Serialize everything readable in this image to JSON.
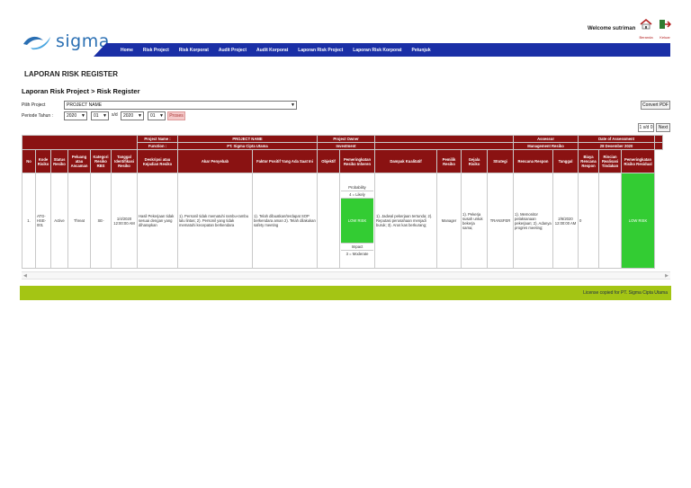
{
  "header": {
    "brand": "sigma",
    "welcome": "Welcome sutriman",
    "home_label": "Beranda",
    "exit_label": "Keluar"
  },
  "nav": {
    "items": [
      "Home",
      "Risk Project",
      "Risk Korporat",
      "Audit Project",
      "Audit Korporat",
      "Laporan Risk Project",
      "Laporan Risk Korporat",
      "Petunjuk"
    ]
  },
  "page": {
    "heading": "LAPORAN RISK REGISTER",
    "breadcrumb": "Laporan Risk Project > Risk Register"
  },
  "filters": {
    "project_label": "Pilih Project",
    "project_value": "PROJECT NAME",
    "periode_label": "Periode Tahun :",
    "year_from": "2020",
    "month_from": "01",
    "sd": "s/d",
    "year_to": "2020",
    "month_to": "01",
    "proses": "Proses",
    "convert_pdf": "Convert PDF",
    "pager": "1 s/d 0",
    "next": "Next"
  },
  "table": {
    "project_name_label": "Project Name :",
    "project_name_value": "PROJECT NAME",
    "function_label": "Function :",
    "function_value": "PT. Sigma Cipta Utama",
    "project_owner_label": "Project Owner",
    "investment_label": "Investment",
    "assessor_label": "Assessor",
    "management_label": "Management Resiko",
    "date_label": "Date of Assessment",
    "date_value": "28 Desember 2020",
    "columns": [
      "No",
      "Kode Risiko",
      "Status Resiko",
      "Peluang atau Ancaman",
      "Kategori Resiko RBS",
      "Tanggal Identifikasi Resiko",
      "Deskripsi atau Kejadian Resiko",
      "Akar Penyebab",
      "Faktor Positif Yang Ada Saat Ini",
      "Objektif",
      "Pemeringkatan Resiko Inheren",
      "Dampak Kualitatif",
      "Pemilik Resiko",
      "Gejala Risiko",
      "Strategi",
      "Rencana Respon",
      "Tanggal",
      "Biaya Rencana Respon",
      "Rincian Realisasi Tindakan",
      "Pemeringkatan Risiko Residual"
    ],
    "row": {
      "no": "1.",
      "kode": "ATG-HSE-001",
      "status": "Active",
      "peluang": "Threat",
      "kategori": "SE-",
      "tanggal": "1/4/2020 12:00:00 AM",
      "deskripsi": "Hasil Pekerjaan tidak sesuai dengan yang diharapkan",
      "akar": "1). Personil tidak mematuhi rambu-rambu lalu lintas; 2). Personil yang tidak mematuhi kecepatan berkendara",
      "faktor": "1). Telah dibuatkan/terdapat SOP berkendara aman 2). Telah dilakukan safety meeting",
      "objektif": "",
      "probability_label": "Probability",
      "probability_value": "4 = Likely",
      "inheren": "LOW RISK",
      "impact_label": "Impact",
      "impact_value": "3 = Moderate",
      "dampak": "1). Jadwal pekerjaan tertunda; 2). Reputasi perusahaan menjadi buruk; 3). Arus kas berkurang;",
      "pemilik": "Manager",
      "gejala": "1). Pekerja susah untuk bekerja sama;",
      "strategi": "TRANSFER",
      "rencana": "1). Memonitor pelaksanaan pekerjaan; 2). Adanya progres meeting;",
      "tanggal_respon": "2/6/2020 12:00:00 AM",
      "biaya": "0",
      "rincian": "",
      "residual": "LOW RISK"
    }
  },
  "footer": {
    "license": "License copied for PT. Sigma Cipta Utama"
  },
  "colors": {
    "nav_blue": "#1a2fa6",
    "header_red": "#8a1212",
    "risk_green": "#33cc33",
    "footer_green": "#a4c514"
  }
}
